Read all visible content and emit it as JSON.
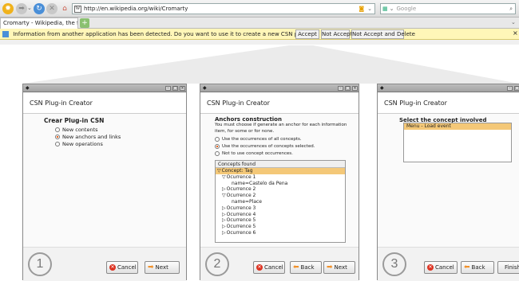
{
  "browser": {
    "url": "http://en.wikipedia.org/wiki/Cromarty",
    "search_placeholder": "Google",
    "tab_title": "Cromarty - Wikipedia, the free e...",
    "tab_add": "+",
    "notification": {
      "text": "Information from another application has been detected. Do you want to use it to create a new CSN plugin?",
      "buttons": [
        "Accept",
        "Not Accept",
        "Not Accept and Delete"
      ],
      "close": "×"
    }
  },
  "dialogs": [
    {
      "step": "1",
      "title": "CSN Plug-in Creator",
      "section_title": "Crear Plug-in CSN",
      "options": [
        {
          "label": "New contents",
          "selected": false
        },
        {
          "label": "New anchors and links",
          "selected": true
        },
        {
          "label": "New operations",
          "selected": false
        }
      ],
      "buttons": {
        "cancel": "Cancel",
        "next": "Next"
      }
    },
    {
      "step": "2",
      "title": "CSN Plug-in Creator",
      "section_title": "Anchors construction",
      "description_1": "You must choose if generate an anchor for each information",
      "description_2": "item, for some or for none.",
      "options": [
        {
          "label": "Use the occurrences of all concepts.",
          "selected": false
        },
        {
          "label": "Use the occurrences of concepts selected.",
          "selected": true
        },
        {
          "label": "Not to use concept occurrences.",
          "selected": false
        }
      ],
      "tree_header": "Concepts found",
      "tree": [
        {
          "text": "Concept: Tag",
          "selected": true,
          "indent": 0,
          "marker": "▽"
        },
        {
          "text": "Ocurrence 1",
          "selected": false,
          "indent": 1,
          "marker": "▽"
        },
        {
          "text": "name=Castelo da Pena",
          "selected": false,
          "indent": 3,
          "marker": ""
        },
        {
          "text": "Ocurrence 2",
          "selected": false,
          "indent": 1,
          "marker": "▷"
        },
        {
          "text": "Ocurrence 2",
          "selected": false,
          "indent": 1,
          "marker": "▽"
        },
        {
          "text": "name=Place",
          "selected": false,
          "indent": 3,
          "marker": ""
        },
        {
          "text": "Ocurrence 3",
          "selected": false,
          "indent": 1,
          "marker": "▷"
        },
        {
          "text": "Ocurrence 4",
          "selected": false,
          "indent": 1,
          "marker": "▷"
        },
        {
          "text": "Ocurrence 5",
          "selected": false,
          "indent": 1,
          "marker": "▷"
        },
        {
          "text": "Ocurrence 5",
          "selected": false,
          "indent": 1,
          "marker": "▷"
        },
        {
          "text": "Ocurrence 6",
          "selected": false,
          "indent": 1,
          "marker": "▷"
        }
      ],
      "buttons": {
        "cancel": "Cancel",
        "back": "Back",
        "next": "Next"
      }
    },
    {
      "step": "3",
      "title": "CSN Plug-in Creator",
      "section_title": "Select the concept involved",
      "list": [
        "Menu - Load event"
      ],
      "buttons": {
        "cancel": "Cancel",
        "back": "Back",
        "finish": "Finish"
      }
    }
  ]
}
